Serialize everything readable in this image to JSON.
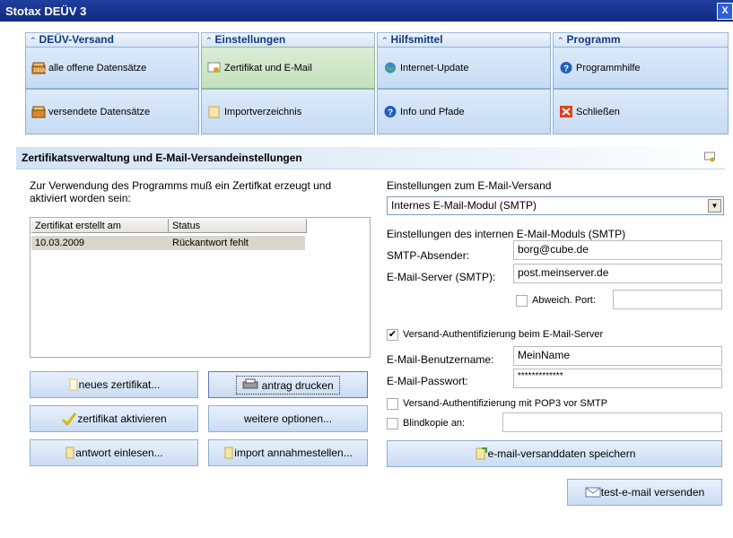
{
  "window": {
    "title": "Stotax DEÜV 3",
    "close_label": "X"
  },
  "ribbon": {
    "groups": [
      {
        "title": "DEÜV-Versand",
        "items": [
          "alle offene Datensätze",
          "versendete Datensätze"
        ]
      },
      {
        "title": "Einstellungen",
        "items": [
          "Zertifikat und E-Mail",
          "Importverzeichnis"
        ]
      },
      {
        "title": "Hilfsmittel",
        "items": [
          "Internet-Update",
          "Info und Pfade"
        ]
      },
      {
        "title": "Programm",
        "items": [
          "Programmhilfe",
          "Schließen"
        ]
      }
    ]
  },
  "panel": {
    "title": "Zertifikatsverwaltung und E-Mail-Versandeinstellungen"
  },
  "cert": {
    "intro_line1": "Zur Verwendung des Programms muß ein Zertifkat erzeugt und",
    "intro_line2": "aktiviert worden sein:",
    "columns": [
      "Zertifikat erstellt am",
      "Status"
    ],
    "rows": [
      {
        "date": "10.03.2009",
        "status": "Rückantwort fehlt"
      }
    ]
  },
  "buttons": {
    "new_cert": "neues zertifikat...",
    "print_request": "antrag drucken",
    "activate_cert": "zertifikat aktivieren",
    "more_options": "weitere optionen...",
    "read_reply": "antwort einlesen...",
    "import_stations": "import annahmestellen..."
  },
  "email": {
    "section_label": "Einstellungen zum E-Mail-Versand",
    "module_selected": "Internes E-Mail-Modul (SMTP)",
    "internal_label": "Einstellungen des internen E-Mail-Moduls (SMTP)",
    "sender_label": "SMTP-Absender:",
    "sender_value": "borg@cube.de",
    "server_label": "E-Mail-Server (SMTP):",
    "server_value": "post.meinserver.de",
    "port_label": "Abweich. Port:",
    "port_value": "",
    "auth_label": "Versand-Authentifizierung beim E-Mail-Server",
    "auth_checked": true,
    "user_label": "E-Mail-Benutzername:",
    "user_value": "MeinName",
    "pass_label": "E-Mail-Passwort:",
    "pass_value": "*************",
    "pop3_label": "Versand-Authentifizierung mit POP3 vor SMTP",
    "bcc_label": "Blindkopie an:",
    "bcc_value": "",
    "save_label": "e-mail-versanddaten speichern",
    "test_label": "test-e-mail versenden"
  }
}
